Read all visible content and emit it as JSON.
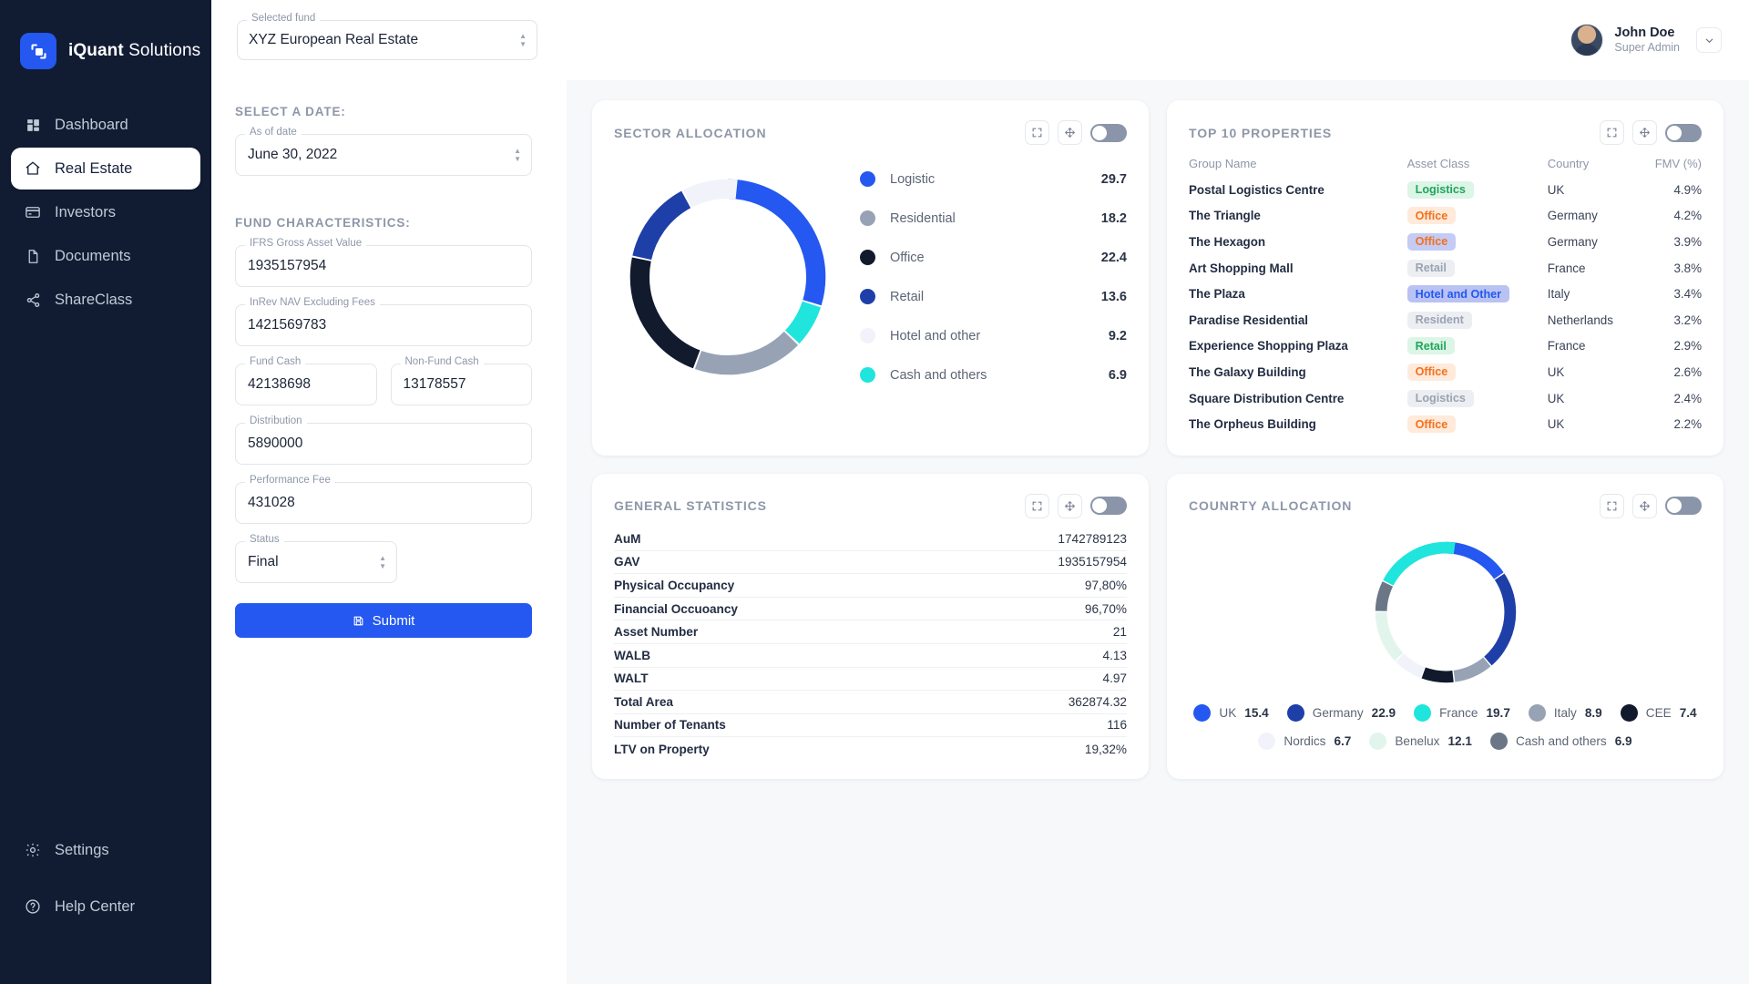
{
  "brand": {
    "name_bold": "iQuant",
    "name_light": " Solutions",
    "logo_icon": "app-logo-icon"
  },
  "sidebar": {
    "items": [
      {
        "label": "Dashboard",
        "icon": "grid-icon",
        "active": false
      },
      {
        "label": "Real Estate",
        "icon": "home-icon",
        "active": true
      },
      {
        "label": "Investors",
        "icon": "card-icon",
        "active": false
      },
      {
        "label": "Documents",
        "icon": "document-icon",
        "active": false
      },
      {
        "label": "ShareClass",
        "icon": "share-icon",
        "active": false
      }
    ],
    "bottom": [
      {
        "label": "Settings",
        "icon": "gear-icon"
      },
      {
        "label": "Help Center",
        "icon": "help-circle-icon"
      }
    ]
  },
  "topbar": {
    "fund_select": {
      "label": "Selected fund",
      "value": "XYZ European Real Estate"
    },
    "user": {
      "name": "John Doe",
      "role": "Super Admin"
    }
  },
  "form": {
    "date_section_title": "SELECT A DATE:",
    "characteristics_title": "FUND CHARACTERISTICS:",
    "fields": [
      {
        "label": "As of date",
        "value": "June 30, 2022",
        "type": "select"
      },
      {
        "label": "IFRS Gross Asset Value",
        "value": "1935157954",
        "type": "text"
      },
      {
        "label": "InRev NAV Excluding Fees",
        "value": "1421569783",
        "type": "text"
      },
      {
        "label": "Fund Cash",
        "value": "42138698",
        "type": "text"
      },
      {
        "label": "Non-Fund Cash",
        "value": "13178557",
        "type": "text"
      },
      {
        "label": "Distribution",
        "value": "5890000",
        "type": "text"
      },
      {
        "label": "Performance Fee",
        "value": "431028",
        "type": "text"
      },
      {
        "label": "Status",
        "value": "Final",
        "type": "select"
      }
    ],
    "submit_label": "Submit",
    "submit_icon": "save-icon"
  },
  "cards": {
    "sector": {
      "title": "SECTOR ALLOCATION",
      "expand_icon": "expand-icon",
      "move_icon": "move-icon",
      "toggle_name": "sector-toggle"
    },
    "top10": {
      "title": "TOP 10 PROPERTIES",
      "expand_icon": "expand-icon",
      "move_icon": "move-icon",
      "toggle_name": "top10-toggle"
    },
    "stats": {
      "title": "GENERAL STATISTICS",
      "expand_icon": "expand-icon",
      "move_icon": "move-icon",
      "toggle_name": "stats-toggle"
    },
    "country": {
      "title": "COUNRTY ALLOCATION",
      "expand_icon": "expand-icon",
      "move_icon": "move-icon",
      "toggle_name": "country-toggle"
    }
  },
  "chart_data": [
    {
      "type": "pie",
      "title": "SECTOR ALLOCATION",
      "legend_position": "right",
      "categories": [
        "Logistic",
        "Residential",
        "Office",
        "Retail",
        "Hotel and other",
        "Cash and others"
      ],
      "values": [
        29.7,
        18.2,
        22.4,
        13.6,
        9.2,
        6.9
      ],
      "colors": [
        "#2458f0",
        "#97a3b4",
        "#121a2e",
        "#1f3fa8",
        "#f2f3fa",
        "#1fe5dd"
      ]
    },
    {
      "type": "pie",
      "title": "COUNRTY ALLOCATION",
      "legend_position": "bottom",
      "categories": [
        "UK",
        "Germany",
        "France",
        "Italy",
        "CEE",
        "Nordics",
        "Benelux",
        "Cash and others"
      ],
      "values": [
        15.4,
        22.9,
        19.7,
        8.9,
        7.4,
        6.7,
        12.1,
        6.9
      ],
      "colors": [
        "#2458f0",
        "#1f3fa8",
        "#1fe5dd",
        "#97a3b4",
        "#111a2c",
        "#f2f3fa",
        "#e2f5ec",
        "#6b7686"
      ]
    }
  ],
  "top10_table": {
    "columns": [
      "Group Name",
      "Asset Class",
      "Country",
      "FMV (%)"
    ],
    "rows": [
      {
        "name": "Postal Logistics Centre",
        "asset_class": "Logistics",
        "badge": "bg-green",
        "country": "UK",
        "fmv": "4.9%"
      },
      {
        "name": "The Triangle",
        "asset_class": "Office",
        "badge": "bg-orange",
        "country": "Germany",
        "fmv": "4.2%"
      },
      {
        "name": "The Hexagon",
        "asset_class": "Office",
        "badge": "bg-blueorange",
        "country": "Germany",
        "fmv": "3.9%"
      },
      {
        "name": "Art Shopping Mall",
        "asset_class": "Retail",
        "badge": "bg-gray",
        "country": "France",
        "fmv": "3.8%"
      },
      {
        "name": "The Plaza",
        "asset_class": "Hotel and Other",
        "badge": "bg-indigo",
        "country": "Italy",
        "fmv": "3.4%"
      },
      {
        "name": "Paradise Residential",
        "asset_class": "Resident",
        "badge": "bg-gray",
        "country": "Netherlands",
        "fmv": "3.2%"
      },
      {
        "name": "Experience Shopping Plaza",
        "asset_class": "Retail",
        "badge": "bg-green",
        "country": "France",
        "fmv": "2.9%"
      },
      {
        "name": "The Galaxy Building",
        "asset_class": "Office",
        "badge": "bg-orange",
        "country": "UK",
        "fmv": "2.6%"
      },
      {
        "name": "Square Distribution Centre",
        "asset_class": "Logistics",
        "badge": "bg-gray",
        "country": "UK",
        "fmv": "2.4%"
      },
      {
        "name": "The Orpheus Building",
        "asset_class": "Office",
        "badge": "bg-orange",
        "country": "UK",
        "fmv": "2.2%"
      }
    ]
  },
  "general_statistics": {
    "rows": [
      {
        "key": "AuM",
        "value": "1742789123"
      },
      {
        "key": "GAV",
        "value": "1935157954"
      },
      {
        "key": "Physical Occupancy",
        "value": "97,80%"
      },
      {
        "key": "Financial Occuoancy",
        "value": "96,70%"
      },
      {
        "key": "Asset Number",
        "value": "21"
      },
      {
        "key": "WALB",
        "value": "4.13"
      },
      {
        "key": "WALT",
        "value": "4.97"
      },
      {
        "key": "Total Area",
        "value": "362874.32"
      },
      {
        "key": "Number of Tenants",
        "value": "116"
      },
      {
        "key": "LTV on Property",
        "value": "19,32%"
      }
    ]
  }
}
